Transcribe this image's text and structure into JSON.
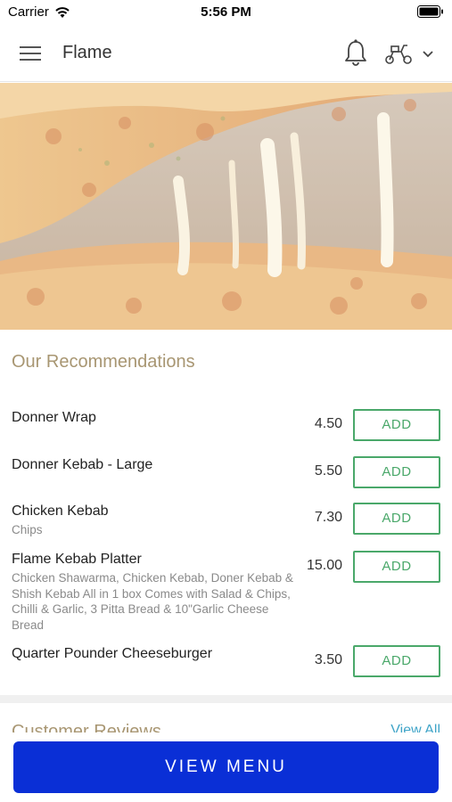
{
  "status_bar": {
    "carrier": "Carrier",
    "time": "5:56 PM",
    "wifi_icon": "wifi-icon",
    "battery_icon": "battery-icon"
  },
  "app_bar": {
    "title": "Flame",
    "menu_icon": "hamburger-menu-icon",
    "notification_icon": "bell-icon",
    "delivery_icon": "scooter-icon",
    "dropdown_icon": "chevron-down-icon"
  },
  "hero": {
    "image": "cheese-pizza-photo"
  },
  "recommendations": {
    "title": "Our Recommendations",
    "items": [
      {
        "name": "Donner Wrap",
        "description": "",
        "price": "4.50",
        "button": "ADD"
      },
      {
        "name": "Donner Kebab - Large",
        "description": "",
        "price": "5.50",
        "button": "ADD"
      },
      {
        "name": "Chicken Kebab",
        "description": "Chips",
        "price": "7.30",
        "button": "ADD"
      },
      {
        "name": "Flame Kebab Platter",
        "description": "Chicken Shawarma, Chicken Kebab, Doner Kebab & Shish Kebab  All in 1 box   Comes with Salad & Chips, Chilli & Garlic,  3 Pitta Bread & 10\"Garlic Cheese Bread",
        "price": "15.00",
        "button": "ADD"
      },
      {
        "name": "Quarter Pounder Cheeseburger",
        "description": "",
        "price": "3.50",
        "button": "ADD"
      }
    ]
  },
  "reviews": {
    "title": "Customer Reviews",
    "link": "View All"
  },
  "cta": {
    "label": "VIEW MENU"
  },
  "colors": {
    "accent_gold": "#a89672",
    "add_green": "#4aa86a",
    "cta_blue": "#0a2fd6",
    "link_blue": "#3fa4c8"
  }
}
